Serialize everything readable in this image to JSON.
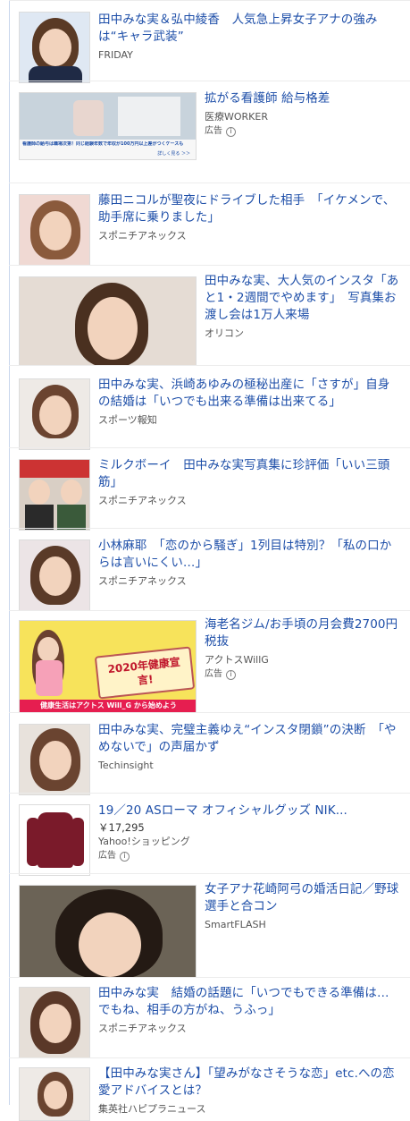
{
  "articles": [
    {
      "title": "田中みな実＆弘中綾香　人気急上昇女子アナの強みは“キャラ武装”",
      "source": "FRIDAY"
    },
    {
      "title": "拡がる看護師 給与格差",
      "source": "医療WORKER",
      "ad": "広告",
      "thumb_headline": "看護師の給与は職場次第！同じ経験年数で年収が100万円以上差がつくケースも",
      "thumb_more": "詳しく見る ＞＞"
    },
    {
      "title": "藤田ニコルが聖夜にドライブした相手　「イケメンで、助手席に乗りました」",
      "source": "スポニチアネックス"
    },
    {
      "title": "田中みな実、大人気のインスタ「あと1・2週間でやめます」　写真集お渡し会は1万人来場",
      "source": "オリコン"
    },
    {
      "title": "田中みな実、浜崎あゆみの極秘出産に「さすが」自身の結婚は「いつでも出来る準備は出来てる」",
      "source": "スポーツ報知"
    },
    {
      "title": "ミルクボーイ　田中みな実写真集に珍評価「いい三頭筋」",
      "source": "スポニチアネックス"
    },
    {
      "title": "小林麻耶　「恋のから騒ぎ」1列目は特別？「私の口からは言いにくい…」",
      "source": "スポニチアネックス"
    },
    {
      "title": "海老名ジム/お手頃の月会費2700円税抜",
      "source": "アクトスWillG",
      "ad": "広告",
      "thumb_badge": "2020年健康宣言!",
      "thumb_banner": "健康生活はアクトス Will_G から始めよう"
    },
    {
      "title": "田中みな実、完璧主義ゆえ“インスタ閉鎖”の決断　「やめないで」の声届かず",
      "source": "Techinsight"
    },
    {
      "title": "19／20 ASローマ オフィシャルグッズ NIK...",
      "price": "￥17,295",
      "source": "Yahoo!ショッピング",
      "ad": "広告"
    },
    {
      "title": "女子アナ花崎阿弓の婚活日記／野球選手と合コン",
      "source": "SmartFLASH"
    },
    {
      "title": "田中みな実　結婚の話題に「いつでもできる準備は…でもね、相手の方がね、うふっ」",
      "source": "スポニチアネックス"
    },
    {
      "title": "【田中みな実さん】「望みがなさそうな恋」etc.への恋愛アドバイスとは？",
      "source": "集英社ハピプラニュース"
    }
  ],
  "colors": {
    "link": "#1d4ea8",
    "accent": "#c9d7ec"
  },
  "icons": {
    "ad_info": "info-icon"
  }
}
